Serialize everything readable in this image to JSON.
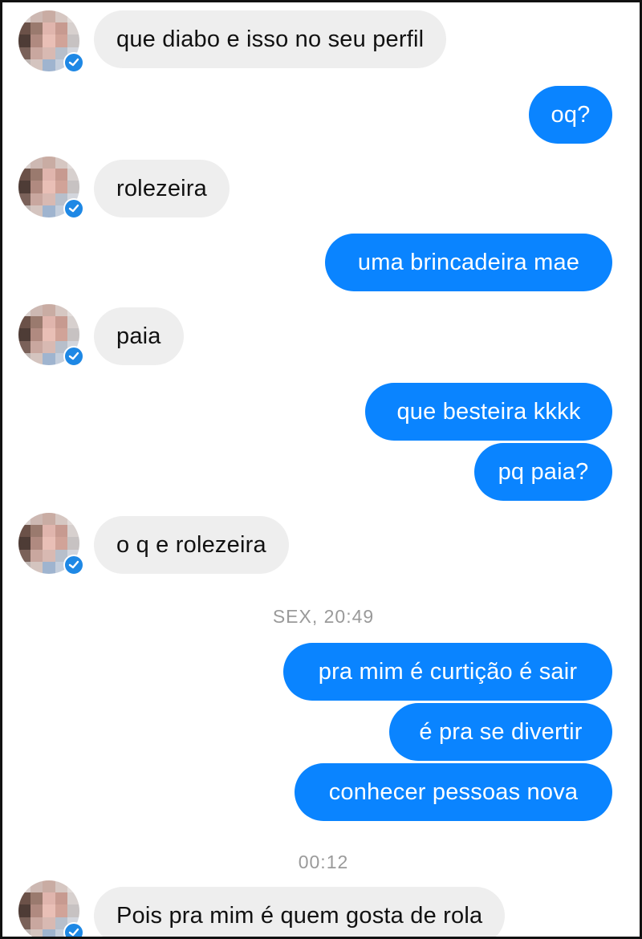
{
  "messages": [
    {
      "sender": "contact",
      "text": "que diabo e isso no seu perfil"
    },
    {
      "sender": "me",
      "text": "oq?"
    },
    {
      "sender": "contact",
      "text": "rolezeira"
    },
    {
      "sender": "me",
      "text": "uma brincadeira mae"
    },
    {
      "sender": "contact",
      "text": "paia"
    },
    {
      "sender": "me",
      "text": "que besteira kkkk"
    },
    {
      "sender": "me",
      "text": "pq paia?"
    },
    {
      "sender": "contact",
      "text": "o q e rolezeira"
    },
    {
      "sender": "me",
      "text": "pra mim é curtição é sair"
    },
    {
      "sender": "me",
      "text": "é pra se divertir"
    },
    {
      "sender": "me",
      "text": "conhecer pessoas nova"
    },
    {
      "sender": "contact",
      "text": "Pois pra mim é quem gosta de rola"
    }
  ],
  "timestamps": [
    "SEX, 20:49",
    "00:12"
  ],
  "colors": {
    "outgoing_bubble": "#0a84ff",
    "incoming_bubble": "#eeeeee",
    "seen_badge": "#1e88e5"
  },
  "icons": {
    "contact_avatar": "pixelated-avatar-icon",
    "seen_indicator": "messenger-seen-badge-icon"
  }
}
